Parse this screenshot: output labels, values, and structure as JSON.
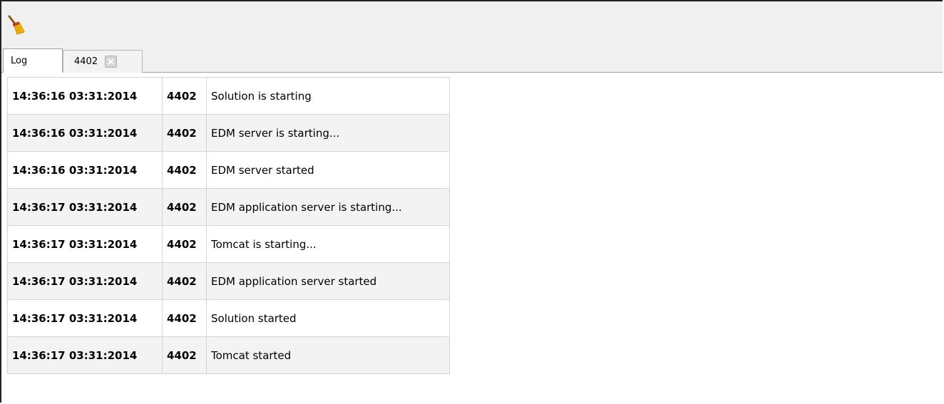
{
  "toolbar": {
    "icons": [
      "broom-icon"
    ]
  },
  "tabs": [
    {
      "label": "Log",
      "active": true,
      "closable": false
    },
    {
      "label": "4402",
      "active": false,
      "closable": true
    }
  ],
  "log": {
    "rows": [
      {
        "timestamp": "14:36:16 03:31:2014",
        "pid": "4402",
        "message": "Solution is starting"
      },
      {
        "timestamp": "14:36:16 03:31:2014",
        "pid": "4402",
        "message": "EDM server is starting..."
      },
      {
        "timestamp": "14:36:16 03:31:2014",
        "pid": "4402",
        "message": "EDM server started"
      },
      {
        "timestamp": "14:36:17 03:31:2014",
        "pid": "4402",
        "message": "EDM application server is starting..."
      },
      {
        "timestamp": "14:36:17 03:31:2014",
        "pid": "4402",
        "message": "Tomcat is starting..."
      },
      {
        "timestamp": "14:36:17 03:31:2014",
        "pid": "4402",
        "message": "EDM application server started"
      },
      {
        "timestamp": "14:36:17 03:31:2014",
        "pid": "4402",
        "message": "Solution started"
      },
      {
        "timestamp": "14:36:17 03:31:2014",
        "pid": "4402",
        "message": "Tomcat started"
      }
    ]
  }
}
